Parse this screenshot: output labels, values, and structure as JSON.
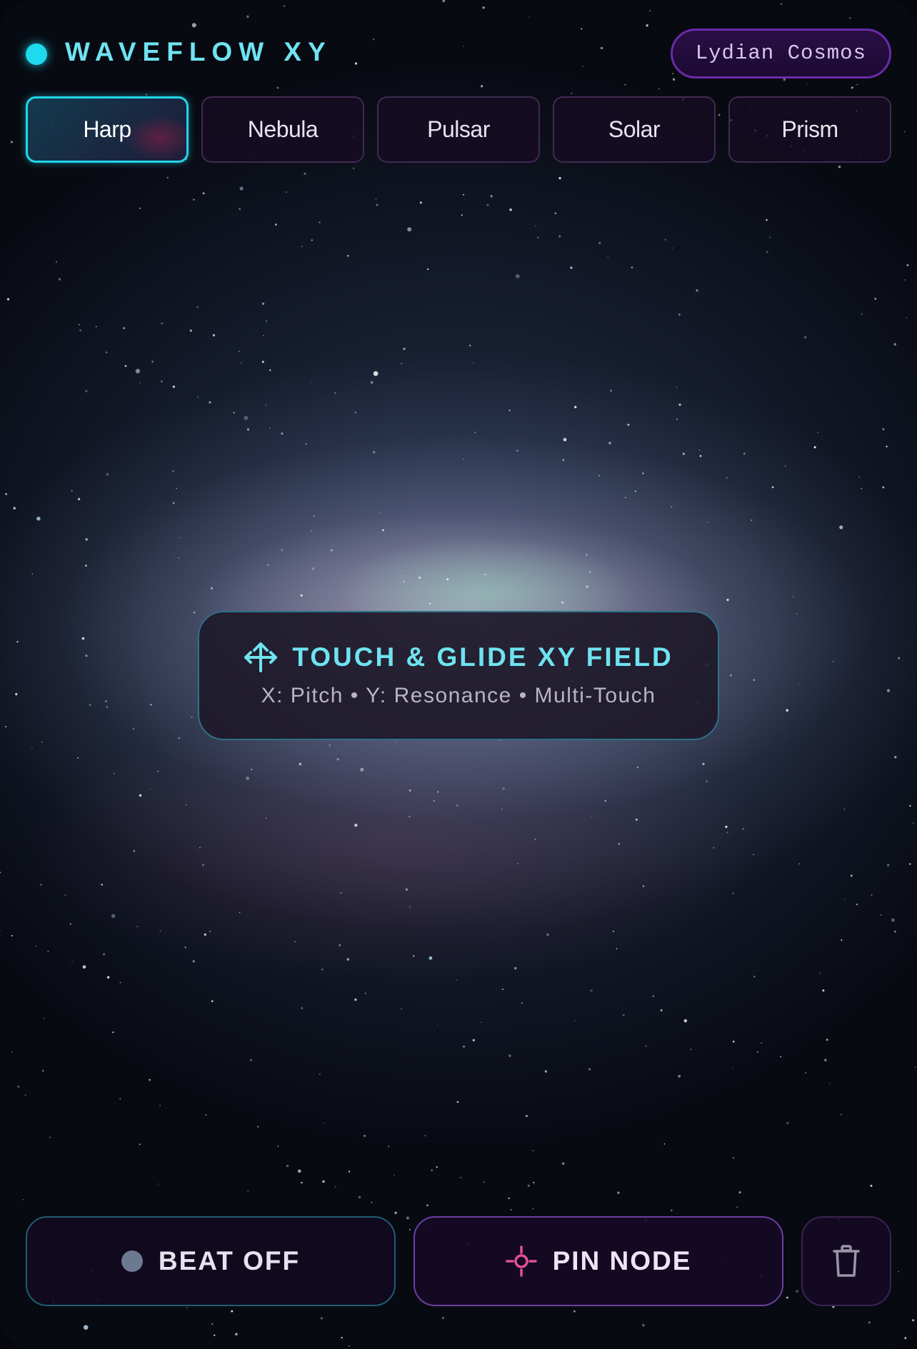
{
  "header": {
    "title": "WAVEFLOW XY",
    "scale_badge": "Lydian Cosmos",
    "accent_color": "#1fd9ee"
  },
  "presets": [
    {
      "label": "Harp",
      "active": true
    },
    {
      "label": "Nebula",
      "active": false
    },
    {
      "label": "Pulsar",
      "active": false
    },
    {
      "label": "Solar",
      "active": false
    },
    {
      "label": "Prism",
      "active": false
    }
  ],
  "xy_field": {
    "icon": "move-arrows-icon",
    "title": "TOUCH & GLIDE XY FIELD",
    "subtitle": "X: Pitch • Y: Resonance • Multi-Touch"
  },
  "controls": {
    "beat_label": "BEAT OFF",
    "beat_indicator_color": "#6d7891",
    "pin_label": "PIN NODE",
    "pin_icon": "crosshair-icon",
    "pin_icon_color": "#e64f9a",
    "clear_icon": "trash-icon"
  }
}
